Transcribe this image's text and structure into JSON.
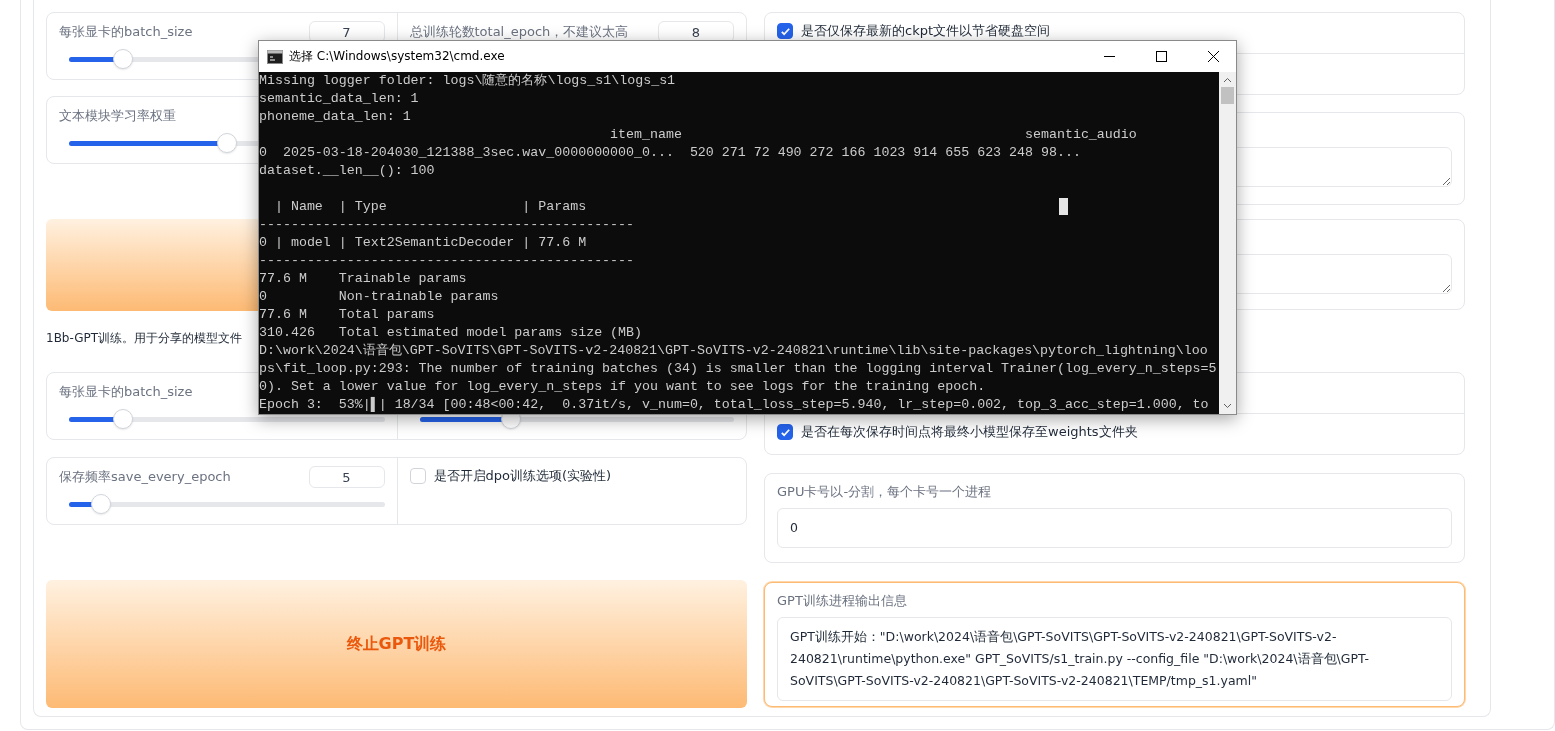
{
  "left_column": [
    {
      "kind": "card",
      "cells": [
        {
          "kind": "slider",
          "label": "每张显卡的batch_size",
          "value": "7",
          "level": 0.17
        },
        {
          "kind": "slider",
          "label": "总训练轮数total_epoch，不建议太高",
          "value": "8"
        }
      ]
    },
    {
      "kind": "card",
      "cells": [
        {
          "kind": "slider",
          "label": "文本模块学习率权重",
          "level": 0.5
        }
      ]
    },
    {
      "kind": "button"
    },
    {
      "kind": "note",
      "text": "1Bb-GPT训练。用于分享的模型文件"
    },
    {
      "kind": "card",
      "cells": [
        {
          "kind": "slider",
          "label": "每张显卡的batch_size",
          "level": 0.17
        },
        {
          "kind": "slider",
          "level": 0.29
        }
      ]
    },
    {
      "kind": "card",
      "cells": [
        {
          "kind": "slider",
          "label": "保存频率save_every_epoch",
          "value": "5",
          "level": 0.1
        },
        {
          "kind": "checkbox",
          "label": "是否开启dpo训练选项(实验性)",
          "checked": false
        }
      ]
    },
    {
      "kind": "button",
      "label": "终止GPT训练"
    }
  ],
  "right_column": [
    {
      "kind": "card",
      "cells": [
        {
          "kind": "checkbox",
          "label": "是否仅保存最新的ckpt文件以节省硬盘空间",
          "checked": true
        },
        {
          "kind": "blank"
        }
      ]
    },
    {
      "kind": "card",
      "cells": [
        {
          "kind": "textarea"
        }
      ]
    },
    {
      "kind": "card",
      "cells": [
        {
          "kind": "textarea"
        }
      ]
    },
    {
      "kind": "card",
      "cells": [
        {
          "kind": "blank"
        },
        {
          "kind": "checkbox",
          "label": "是否在每次保存时间点将最终小模型保存至weights文件夹",
          "checked": true
        }
      ]
    },
    {
      "kind": "card",
      "cells": [
        {
          "kind": "textarea",
          "label": "GPU卡号以-分割，每个卡号一个进程",
          "value": "0"
        }
      ]
    },
    {
      "kind": "card",
      "highlighted": true,
      "cells": [
        {
          "kind": "textarea",
          "label": "GPT训练进程输出信息",
          "value": "GPT训练开始：\"D:\\work\\2024\\语音包\\GPT-SoVITS\\GPT-SoVITS-v2-240821\\GPT-SoVITS-v2-240821\\runtime\\python.exe\" GPT_SoVITS/s1_train.py --config_file \"D:\\work\\2024\\语音包\\GPT-SoVITS\\GPT-SoVITS-v2-240821\\GPT-SoVITS-v2-240821\\TEMP/tmp_s1.yaml\""
        }
      ]
    }
  ],
  "console_window": {
    "title": "选择 C:\\Windows\\system32\\cmd.exe",
    "blocks": [
      [
        "Missing logger folder: logs\\随意的名称\\logs_s1\\logs_s1",
        "semantic_data_len: 1",
        "phoneme_data_len: 1",
        "                                            item_name                                           semantic_audio",
        "0  2025-03-18-204030_121388_3sec.wav_0000000000_0...  520 271 72 490 272 166 1023 914 655 623 248 98...",
        "dataset.__len__(): 100"
      ],
      [
        "  | Name  | Type                 | Params",
        "-----------------------------------------------",
        "0 | model | Text2SemanticDecoder | 77.6 M",
        "-----------------------------------------------",
        "77.6 M    Trainable params",
        "0         Non-trainable params",
        "77.6 M    Total params",
        "310.426   Total estimated model params size (MB)",
        "D:\\work\\2024\\语音包\\GPT-SoVITS\\GPT-SoVITS-v2-240821\\GPT-SoVITS-v2-240821\\runtime\\lib\\site-packages\\pytorch_lightning\\loo",
        "ps\\fit_loop.py:293: The number of training batches (34) is smaller than the logging interval Trainer(log_every_n_steps=5",
        "0). Set a lower value for log_every_n_steps if you want to see logs for the training epoch.",
        "Epoch 3:  53%|▌| 18/34 [00:48<00:42,  0.37it/s, v_num=0, total_loss_step=5.940, lr_step=0.002, top_3_acc_step=1.000, to"
      ]
    ]
  }
}
